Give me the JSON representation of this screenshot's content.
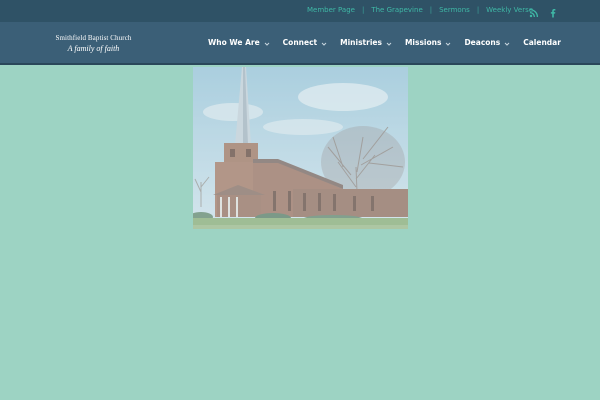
{
  "topbar": {
    "links": [
      "Member Page",
      "The Grapevine",
      "Sermons",
      "Weekly Verse"
    ],
    "separator": "|",
    "social": [
      {
        "icon": "rss-icon",
        "color": "#3fb8a6"
      },
      {
        "icon": "facebook-icon",
        "color": "#3fb8a6"
      }
    ]
  },
  "brand": {
    "name": "Smithfield Baptist Church",
    "tagline": "A family of faith"
  },
  "nav": {
    "items": [
      {
        "label": "Who We Are",
        "has_dropdown": true
      },
      {
        "label": "Connect",
        "has_dropdown": true
      },
      {
        "label": "Ministries",
        "has_dropdown": true
      },
      {
        "label": "Missions",
        "has_dropdown": true
      },
      {
        "label": "Deacons",
        "has_dropdown": true
      },
      {
        "label": "Calendar",
        "has_dropdown": false
      }
    ]
  },
  "colors": {
    "page_background": "#9dd3c3",
    "topbar": "#2f5266",
    "header": "#3b5f77",
    "accent": "#3fb8a6"
  }
}
